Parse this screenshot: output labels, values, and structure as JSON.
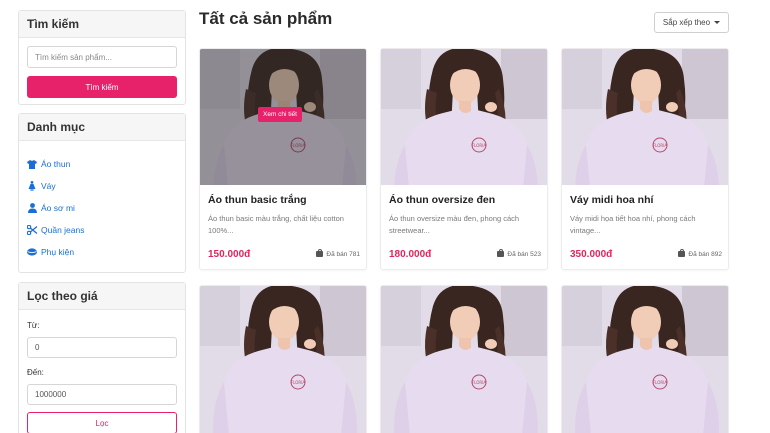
{
  "search": {
    "title": "Tìm kiếm",
    "placeholder": "Tìm kiếm sản phẩm...",
    "button": "Tìm kiếm"
  },
  "categories": {
    "title": "Danh mục",
    "items": [
      {
        "label": "Áo thun",
        "icon": "tshirt-icon"
      },
      {
        "label": "Váy",
        "icon": "dress-icon"
      },
      {
        "label": "Áo sơ mi",
        "icon": "user-icon"
      },
      {
        "label": "Quần jeans",
        "icon": "scissors-icon"
      },
      {
        "label": "Phụ kiện",
        "icon": "hat-icon"
      }
    ]
  },
  "price_filter": {
    "title": "Lọc theo giá",
    "from_label": "Từ:",
    "from_value": "0",
    "to_label": "Đến:",
    "to_value": "1000000",
    "button": "Lọc"
  },
  "main": {
    "title": "Tất cả sản phẩm",
    "sort_label": "Sắp xếp theo"
  },
  "products": [
    {
      "name": "Áo thun basic trắng",
      "desc": "Áo thun basic màu trắng, chất liệu cotton 100%...",
      "price": "150.000đ",
      "sold": "Đã bán 781",
      "hover_button": "Xem chi tiết"
    },
    {
      "name": "Áo thun oversize đen",
      "desc": "Áo thun oversize màu đen, phong cách streetwear...",
      "price": "180.000đ",
      "sold": "Đã bán 523"
    },
    {
      "name": "Váy midi hoa nhí",
      "desc": "Váy midi họa tiết hoa nhí, phong cách vintage...",
      "price": "350.000đ",
      "sold": "Đã bán 892"
    }
  ],
  "colors": {
    "accent": "#e8216b",
    "link": "#1a6fd6",
    "price": "#e0245e"
  }
}
